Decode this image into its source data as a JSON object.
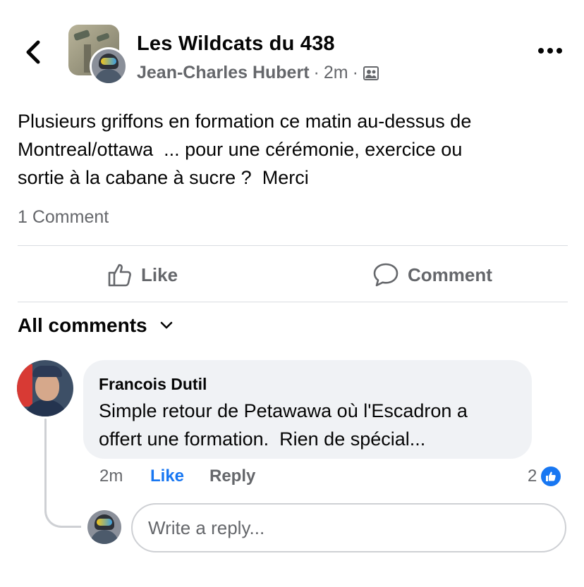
{
  "header": {
    "group_name": "Les Wildcats du 438",
    "author": "Jean-Charles Hubert",
    "separator": "·",
    "time": "2m",
    "back_icon": "chevron-left-icon",
    "more_icon": "more-dots-icon",
    "privacy_icon": "group-members-icon"
  },
  "post": {
    "text": "Plusieurs griffons en formation ce matin au-dessus de\nMontreal/ottawa  ... pour une cérémonie, exercice ou\nsortie à la cabane à sucre ?  Merci",
    "comment_count": "1 Comment"
  },
  "actions": {
    "like_label": "Like",
    "comment_label": "Comment"
  },
  "comments_section": {
    "title": "All comments",
    "chevron_icon": "chevron-down-icon"
  },
  "comment": {
    "author": "Francois Dutil",
    "text": "Simple retour de Petawawa où l'Escadron a\noffert une formation.  Rien de spécial...",
    "time": "2m",
    "like_label": "Like",
    "reply_label": "Reply",
    "reaction_count": "2",
    "reaction_icon": "thumbs-up-icon"
  },
  "reply": {
    "placeholder": "Write a reply..."
  },
  "colors": {
    "accent": "#1877f2",
    "secondary_text": "#65676b",
    "bubble": "#f0f2f5"
  }
}
